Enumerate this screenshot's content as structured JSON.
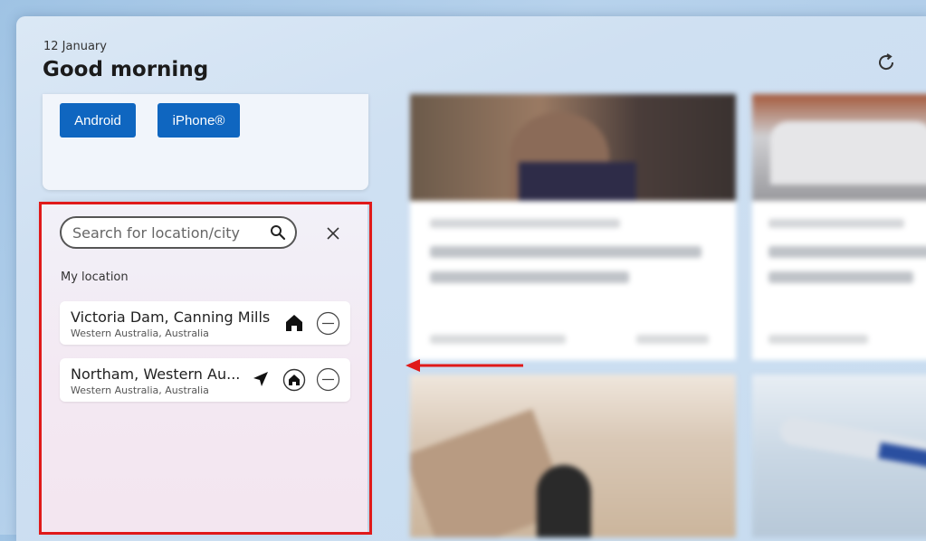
{
  "header": {
    "date": "12 January",
    "greeting": "Good morning"
  },
  "app_buttons": {
    "android": "Android",
    "iphone": "iPhone®"
  },
  "location_panel": {
    "search_placeholder": "Search for location/city",
    "section_label": "My location",
    "locations": [
      {
        "name": "Victoria Dam, Canning Mills",
        "region": "Western Australia, Australia"
      },
      {
        "name": "Northam, Western Au...",
        "region": "Western Australia, Australia"
      }
    ]
  },
  "colors": {
    "accent_button": "#0f66c0",
    "highlight": "#e01a1a"
  }
}
